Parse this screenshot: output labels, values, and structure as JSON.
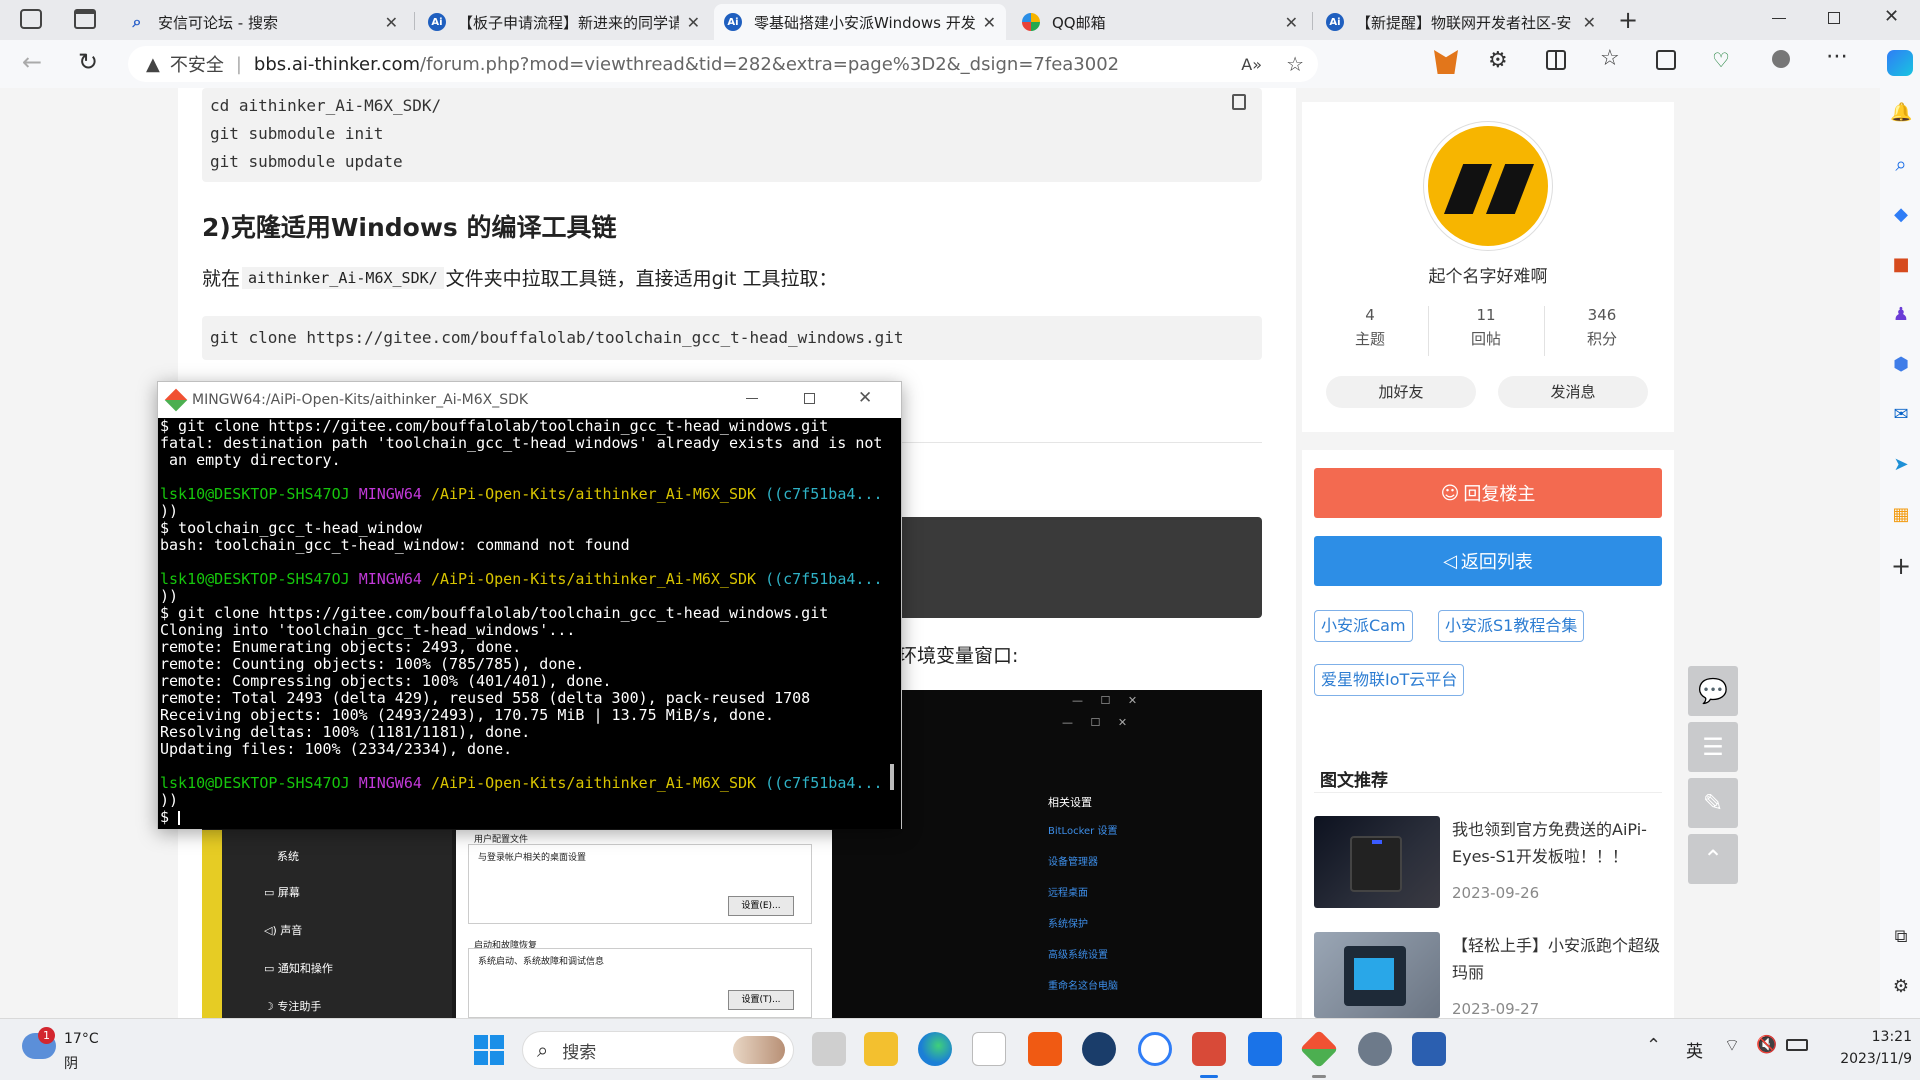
{
  "browser": {
    "tabs": [
      {
        "title": "安信可论坛 - 搜索",
        "favicon": "search-icon"
      },
      {
        "title": "【板子申请流程】新进来的同学请",
        "favicon": "ai-icon"
      },
      {
        "title": "零基础搭建小安派Windows 开发",
        "favicon": "ai-icon"
      },
      {
        "title": "QQ邮箱",
        "favicon": "qq-icon"
      },
      {
        "title": "【新提醒】物联网开发者社区-安",
        "favicon": "ai-icon"
      }
    ],
    "security_label": "不安全",
    "url_domain": "bbs.ai-thinker.com",
    "url_path": "/forum.php?mod=viewthread&tid=282&extra=page%3D2&_dsign=7fea3002"
  },
  "article": {
    "code1_lines": [
      "cd aithinker_Ai-M6X_SDK/",
      "git submodule init",
      "git submodule update"
    ],
    "heading2": "2)克隆适用Windows 的编译工具链",
    "para_prefix": "就在",
    "para_code": "aithinker_Ai-M6X_SDK/",
    "para_suffix": "文件夹中拉取工具链，直接适用git 工具拉取：",
    "code2": "git clone https://gitee.com/bouffalolab/toolchain_gcc_t-head_windows.git",
    "env_text_partial": "环境变量窗口:",
    "screenshot": {
      "system_label": "系统",
      "menu": [
        "屏幕",
        "声音",
        "通知和操作",
        "专注助手"
      ],
      "user_profile_title": "用户配置文件",
      "user_profile_desc": "与登录帐户相关的桌面设置",
      "settings_btn_e": "设置(E)...",
      "startup_title": "启动和故障恢复",
      "startup_desc": "系统启动、系统故障和调试信息",
      "settings_btn_t": "设置(T)...",
      "related_title": "相关设置",
      "related_links": [
        "BitLocker 设置",
        "设备管理器",
        "远程桌面",
        "系统保护",
        "高级系统设置",
        "重命名这台电脑"
      ]
    }
  },
  "profile": {
    "username": "起个名字好难啊",
    "stats": [
      {
        "value": "4",
        "label": "主题"
      },
      {
        "value": "11",
        "label": "回帖"
      },
      {
        "value": "346",
        "label": "积分"
      }
    ],
    "add_friend": "加好友",
    "send_msg": "发消息"
  },
  "actions": {
    "reply": "回复楼主",
    "back": "返回列表"
  },
  "tags": [
    "小安派Cam",
    "小安派S1教程合集",
    "爱星物联IoT云平台"
  ],
  "recommend": {
    "title": "图文推荐",
    "items": [
      {
        "title": "我也领到官方免费送的AiPi-Eyes-S1开发板啦！！！",
        "date": "2023-09-26"
      },
      {
        "title": "【轻松上手】小安派跑个超级玛丽",
        "date": "2023-09-27"
      }
    ]
  },
  "terminal": {
    "title": "MINGW64:/AiPi-Open-Kits/aithinker_Ai-M6X_SDK",
    "user_host": "lsk10@DESKTOP-SHS47OJ",
    "shell": "MINGW64",
    "path": "/AiPi-Open-Kits/aithinker_Ai-M6X_SDK",
    "branch": "((c7f51ba4...",
    "branch_close": "))",
    "block1": "$ git clone https://gitee.com/bouffalolab/toolchain_gcc_t-head_windows.git\nfatal: destination path 'toolchain_gcc_t-head_windows' already exists and is not\n an empty directory.",
    "block2": "$ toolchain_gcc_t-head_window\nbash: toolchain_gcc_t-head_window: command not found",
    "block3": "$ git clone https://gitee.com/bouffalolab/toolchain_gcc_t-head_windows.git\nCloning into 'toolchain_gcc_t-head_windows'...\nremote: Enumerating objects: 2493, done.\nremote: Counting objects: 100% (785/785), done.\nremote: Compressing objects: 100% (401/401), done.\nremote: Total 2493 (delta 429), reused 558 (delta 300), pack-reused 1708\nReceiving objects: 100% (2493/2493), 170.75 MiB | 13.75 MiB/s, done.\nResolving deltas: 100% (1181/1181), done.\nUpdating files: 100% (2334/2334), done.",
    "prompt": "$"
  },
  "taskbar": {
    "weather_temp": "17°C",
    "weather_desc": "阴",
    "weather_badge": "1",
    "search": "搜索",
    "ime": "英",
    "time": "13:21",
    "date": "2023/11/9"
  }
}
